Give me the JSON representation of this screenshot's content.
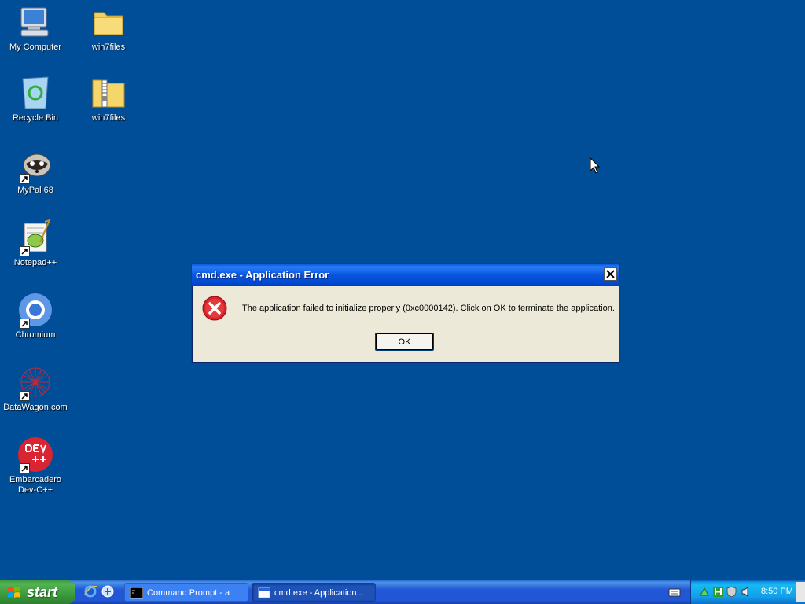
{
  "desktop": {
    "icons": [
      {
        "label": "My Computer"
      },
      {
        "label": "win7files"
      },
      {
        "label": "Recycle Bin"
      },
      {
        "label": "win7files"
      },
      {
        "label": "MyPal 68"
      },
      {
        "label": "Notepad++"
      },
      {
        "label": "Chromium"
      },
      {
        "label": "DataWagon.com"
      },
      {
        "label": "Embarcadero Dev-C++"
      }
    ]
  },
  "dialog": {
    "title": "cmd.exe - Application Error",
    "message": "The application failed to initialize properly (0xc0000142). Click on OK to terminate the application.",
    "ok_label": "OK",
    "icon": "error-icon"
  },
  "taskbar": {
    "start_label": "start",
    "quick_launch": [
      "ie-icon",
      "browser-icon"
    ],
    "tasks": [
      {
        "label": "Command Prompt - a",
        "icon": "cmd-icon"
      },
      {
        "label": "cmd.exe - Application...",
        "icon": "window-icon"
      }
    ],
    "clock": "8:50 PM"
  },
  "colors": {
    "desktop": "#004e98",
    "titlebar": "#0855dd",
    "dialog_bg": "#ece9d8",
    "start_green": "#3b9a3b",
    "tray": "#139ee9"
  }
}
